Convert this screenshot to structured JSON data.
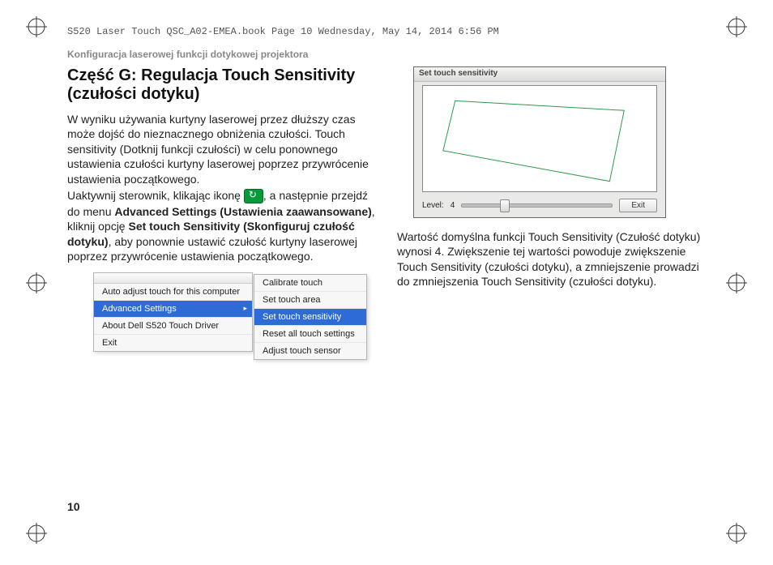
{
  "header_line": "S520 Laser Touch QSC_A02-EMEA.book  Page 10  Wednesday, May 14, 2014  6:56 PM",
  "running_head": "Konfiguracja laserowej funkcji dotykowej projektora",
  "page_number": "10",
  "section_title": "Część G: Regulacja Touch Sensitivity (czułości dotyku)",
  "para1_a": "W wyniku używania kurtyny laserowej przez dłuższy czas może dojść do nieznacznego obniżenia czułości. Touch sensitivity (Dotknij funkcji czułości) w celu ponownego ustawienia czułości kurtyny laserowej poprzez przywrócenie ustawienia początkowego.",
  "para1_b_pre": "Uaktywnij sterownik, klikając ikonę ",
  "para1_b_post1": ", a następnie przejdź do menu ",
  "bold_adv": "Advanced Settings (Ustawienia zaawansowane)",
  "para1_b_post2": ", kliknij opcję ",
  "bold_set": "Set touch Sensitivity (Skonfiguruj czułość dotyku)",
  "para1_b_post3": ", aby ponownie ustawić czułość kurtyny laserowej poprzez przywrócenie ustawienia początkowego.",
  "para2": "Wartość domyślna funkcji Touch Sensitivity (Czułość dotyku) wynosi 4. Zwiększenie tej wartości powoduje zwiększenie Touch Sensitivity (czułości dotyku), a zmniejszenie prowadzi do zmniejszenia Touch Sensitivity (czułości dotyku).",
  "menu_left": {
    "items": [
      "Auto adjust touch for this computer",
      "Advanced Settings",
      "About Dell S520 Touch Driver",
      "Exit"
    ],
    "selected_index": 1
  },
  "menu_right": {
    "items": [
      "Calibrate touch",
      "Set touch area",
      "Set touch sensitivity",
      "Reset all touch settings",
      "Adjust touch sensor"
    ],
    "selected_index": 2
  },
  "sens_window": {
    "title": "Set touch sensitivity",
    "level_label": "Level:",
    "level_value": "4",
    "exit_label": "Exit"
  }
}
